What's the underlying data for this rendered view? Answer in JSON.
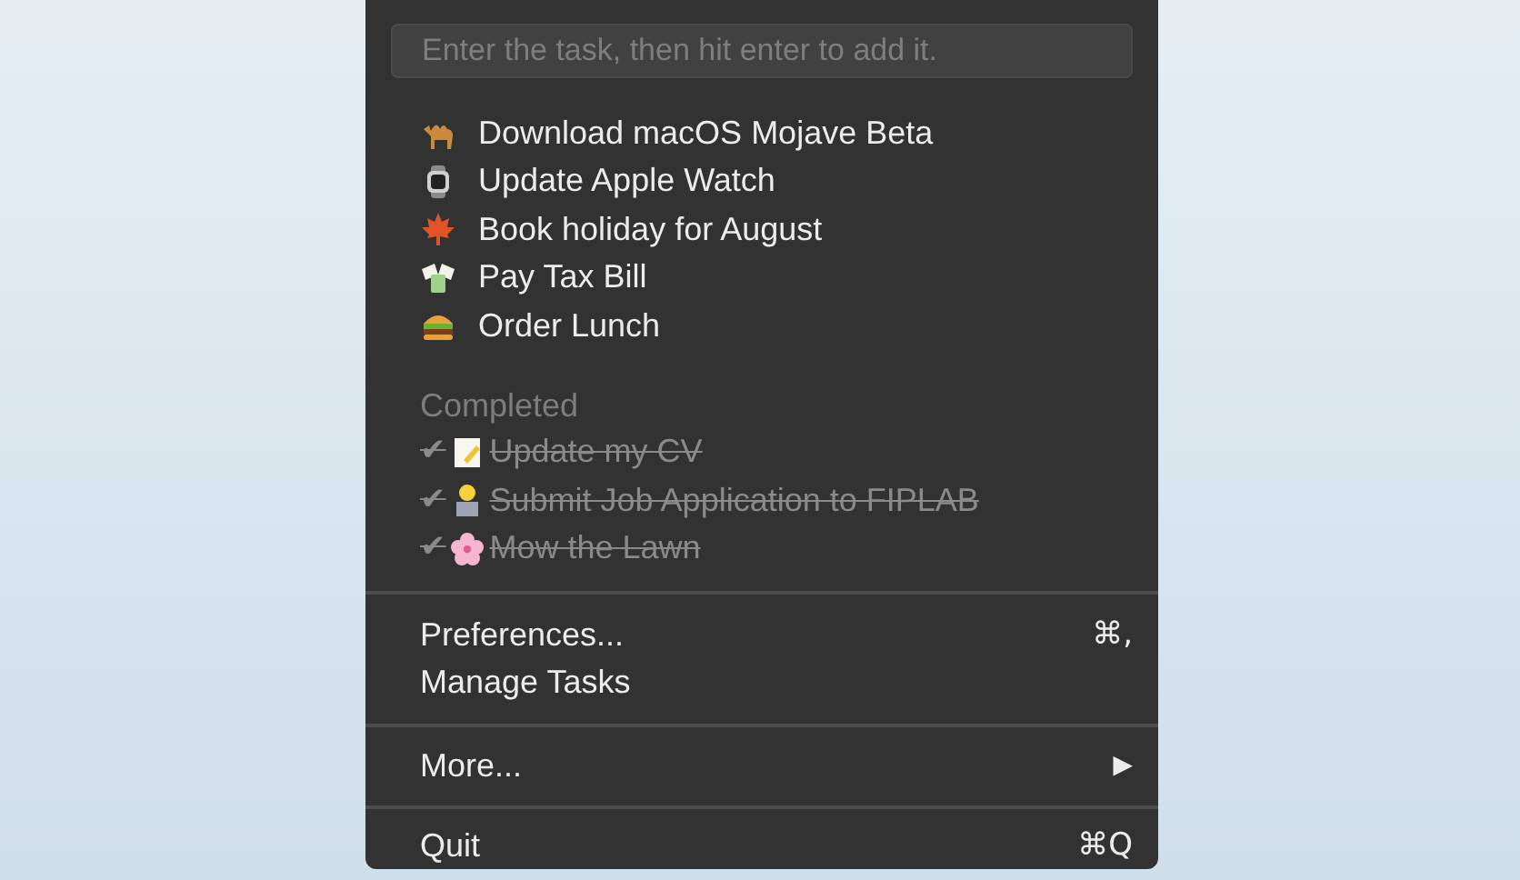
{
  "input": {
    "placeholder": "Enter the task, then hit enter to add it."
  },
  "tasks": [
    {
      "label": "Download macOS Mojave Beta"
    },
    {
      "label": "Update Apple Watch"
    },
    {
      "label": "Book holiday for August"
    },
    {
      "label": "Pay Tax Bill"
    },
    {
      "label": "Order Lunch"
    }
  ],
  "completed": {
    "heading": "Completed",
    "items": [
      {
        "check": "✔",
        "label": "Update my CV"
      },
      {
        "check": "✔",
        "label": "Submit Job Application to FIPLAB"
      },
      {
        "check": "✔",
        "label": "Mow the Lawn"
      }
    ]
  },
  "menu_groups": [
    [
      {
        "label": "Preferences...",
        "shortcut": "⌘,"
      },
      {
        "label": "Manage Tasks"
      }
    ],
    [
      {
        "label": "More...",
        "submenu": "▶"
      }
    ],
    [
      {
        "label": "Quit",
        "shortcut": "⌘Q"
      }
    ]
  ]
}
